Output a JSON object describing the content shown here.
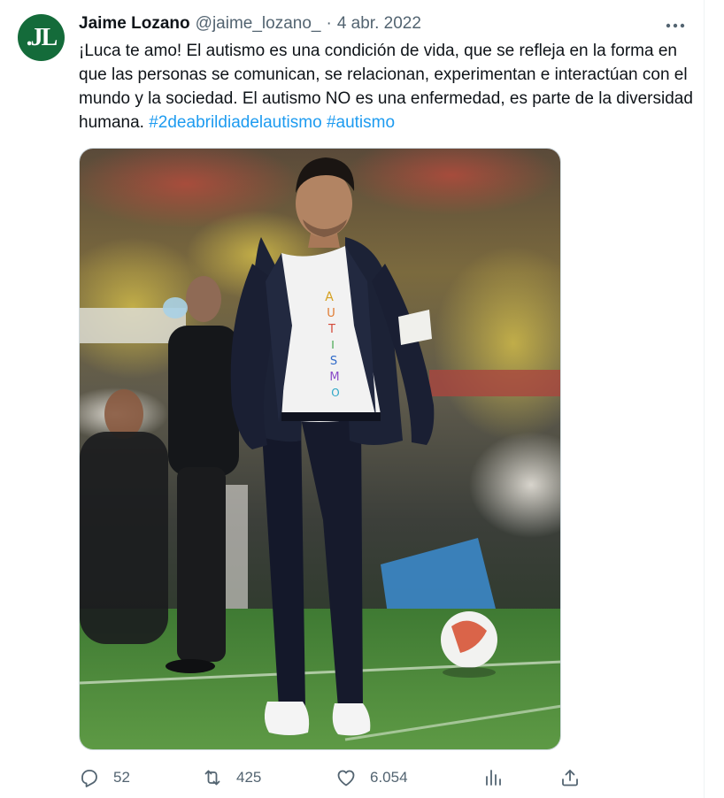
{
  "author": {
    "display_name": "Jaime Lozano",
    "handle": "@jaime_lozano_",
    "separator": "·",
    "date": "4 abr. 2022",
    "avatar_monogram": ".JL"
  },
  "tweet": {
    "body": "¡Luca te amo! El autismo es una condición de vida, que se refleja en la forma en que las personas se comunican, se relacionan, experimentan e interactúan con el mundo y la sociedad. El autismo NO es una enfermedad, es parte de la diversidad humana.",
    "hashtags": [
      "#2deabrildiadelautismo",
      "#autismo"
    ],
    "shirt_text": "AUTISMO"
  },
  "actions": {
    "replies": "52",
    "retweets": "425",
    "likes": "6.054"
  },
  "icons": {
    "more": "more-dots-icon",
    "reply": "reply-icon",
    "retweet": "retweet-icon",
    "like": "heart-icon",
    "views": "analytics-icon",
    "share": "share-icon"
  },
  "colors": {
    "text": "#0f1419",
    "secondary": "#536471",
    "link": "#1d9bf0",
    "avatar_bg": "#146b3a",
    "pitch_green": "#4f8a3a"
  }
}
